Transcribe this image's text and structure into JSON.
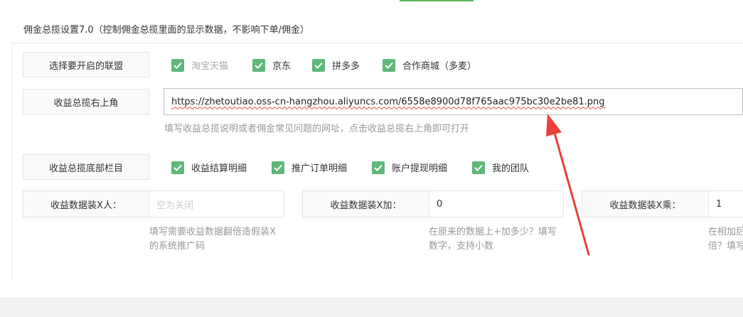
{
  "section_title": "佣金总揽设置7.0（控制佣金总揽里面的显示数据，不影响下单/佣金）",
  "alliance": {
    "label": "选择要开启的联盟",
    "options": [
      {
        "label": "淘宝天猫",
        "checked": true,
        "muted": true
      },
      {
        "label": "京东",
        "checked": true
      },
      {
        "label": "拼多多",
        "checked": true
      },
      {
        "label": "合作商城（多麦）",
        "checked": true
      }
    ]
  },
  "top_right": {
    "label": "收益总揽右上角",
    "value": "https://zhetoutiao.oss-cn-hangzhou.aliyuncs.com/6558e8900d78f765aac975bc30e2be81.png",
    "hint": "填写收益总揽说明或者佣金常见问题的网址，点击收益总揽右上角即可打开"
  },
  "bottom_bar": {
    "label": "收益总揽底部栏目",
    "options": [
      {
        "label": "收益结算明细",
        "checked": true
      },
      {
        "label": "推广订单明细",
        "checked": true
      },
      {
        "label": "账户提现明细",
        "checked": true
      },
      {
        "label": "我的团队",
        "checked": true
      }
    ]
  },
  "fake_person": {
    "label": "收益数据装X人：",
    "placeholder": "空为关闭",
    "hint": "填写需要收益数据翻倍造假装X的系统推广码"
  },
  "fake_add": {
    "label": "收益数据装X加：",
    "value": "0",
    "hint": "在原来的数据上+加多少？填写数字，支持小数"
  },
  "fake_mul": {
    "label": "收益数据装X乘：",
    "value": "1",
    "hint": "在相加后倍？填写"
  },
  "colors": {
    "accent": "#5fb878",
    "arrow": "#e8403a",
    "label_bg": "#fafafa",
    "border": "#e6e6e6"
  }
}
